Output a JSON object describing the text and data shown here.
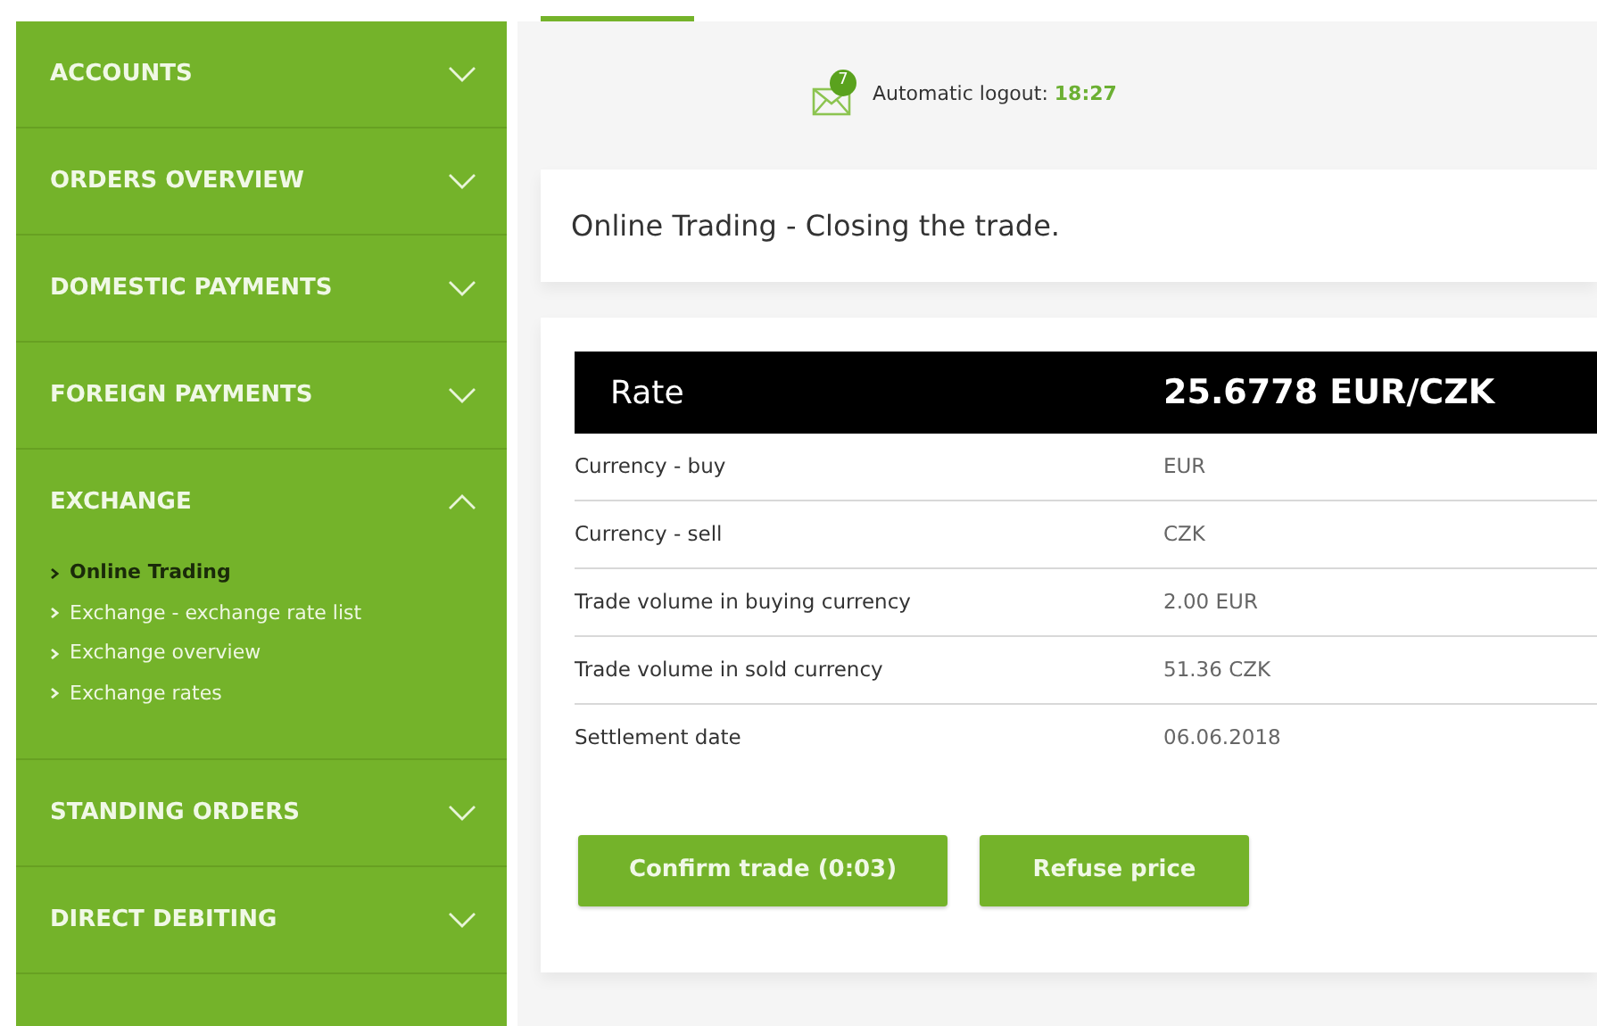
{
  "sidebar": {
    "items": [
      {
        "label": "ACCOUNTS",
        "expanded": false
      },
      {
        "label": "ORDERS OVERVIEW",
        "expanded": false
      },
      {
        "label": "DOMESTIC PAYMENTS",
        "expanded": false
      },
      {
        "label": "FOREIGN PAYMENTS",
        "expanded": false
      },
      {
        "label": "EXCHANGE",
        "expanded": true,
        "children": [
          {
            "label": "Online Trading",
            "selected": true
          },
          {
            "label": "Exchange - exchange rate list",
            "selected": false
          },
          {
            "label": "Exchange overview",
            "selected": false
          },
          {
            "label": "Exchange rates",
            "selected": false
          }
        ]
      },
      {
        "label": "STANDING ORDERS",
        "expanded": false
      },
      {
        "label": "DIRECT DEBITING",
        "expanded": false
      }
    ]
  },
  "header": {
    "message_count": "7",
    "logout_label": "Automatic logout:",
    "logout_time": "18:27"
  },
  "page_title": "Online Trading - Closing the trade.",
  "rate": {
    "label": "Rate",
    "value": "25.6778 EUR/CZK"
  },
  "details": [
    {
      "label": "Currency - buy",
      "value": "EUR"
    },
    {
      "label": "Currency - sell",
      "value": "CZK"
    },
    {
      "label": "Trade volume in buying currency",
      "value": "2.00 EUR"
    },
    {
      "label": "Trade volume in sold currency",
      "value": "51.36 CZK"
    },
    {
      "label": "Settlement date",
      "value": "06.06.2018"
    }
  ],
  "buttons": [
    "Confirm trade (0:03)",
    "Refuse price"
  ]
}
